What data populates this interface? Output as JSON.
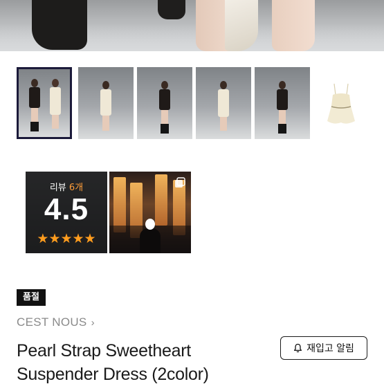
{
  "gallery": {
    "thumbnails": [
      {
        "alt": "two models"
      },
      {
        "alt": "cream model"
      },
      {
        "alt": "black model"
      },
      {
        "alt": "cream model"
      },
      {
        "alt": "black model"
      },
      {
        "alt": "cream dress"
      }
    ],
    "selected_index": 0
  },
  "reviews": {
    "label": "리뷰",
    "count": "6개",
    "score": "4.5",
    "stars": "★★★★★",
    "star_color": "#ff9d1e",
    "count_color": "#ff9d3a"
  },
  "product": {
    "status_badge": "품절",
    "brand": "CEST NOUS",
    "brand_chevron": "›",
    "title_line1": "Pearl Strap Sweetheart",
    "title_line2": "Suspender Dress (2color)",
    "restock_button": "재입고 알림",
    "restock_icon": "bell-icon"
  }
}
